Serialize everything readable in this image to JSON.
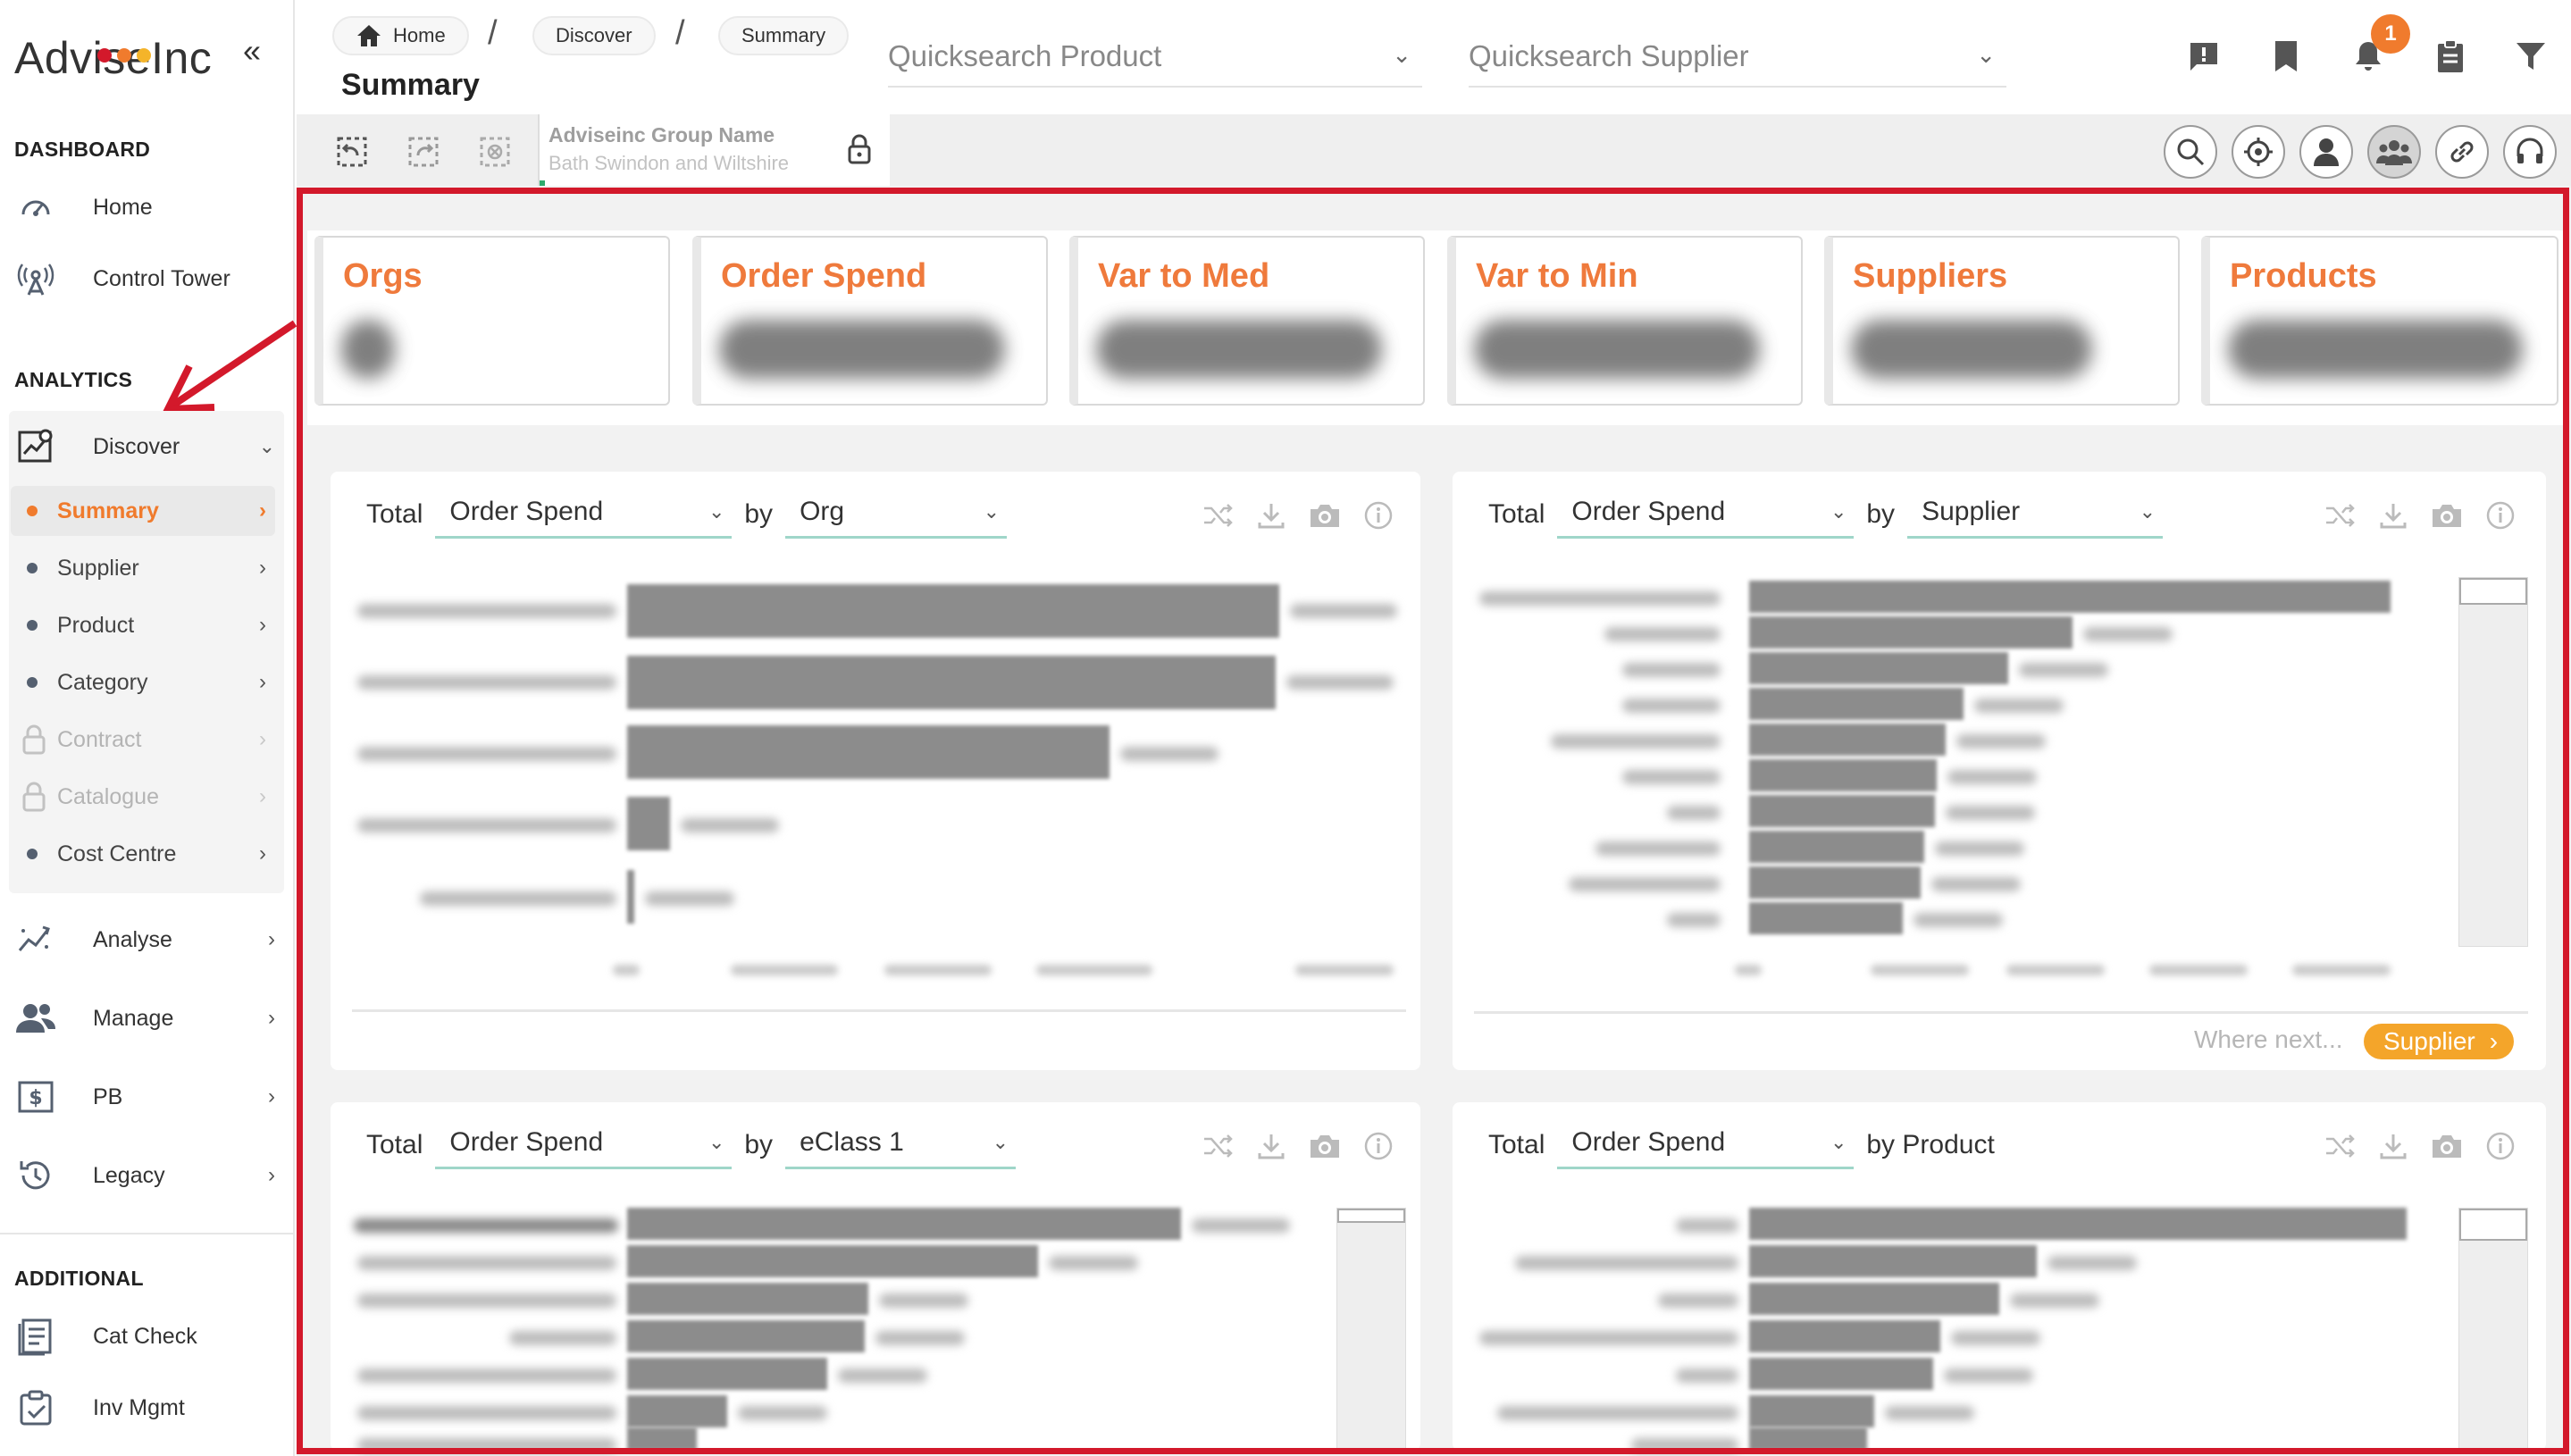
{
  "app": {
    "logo_text": "AdviseInc",
    "collapse_glyph": "«"
  },
  "colors": {
    "accent": "#f07b2d",
    "highlight_border": "#d3192b",
    "kpi_title": "#ef7a3c",
    "select_underline": "#9fd6c9",
    "next_pill": "#f4a52a"
  },
  "sidebar": {
    "dashboard_heading": "DASHBOARD",
    "dashboard_items": [
      {
        "label": "Home",
        "icon": "speedometer-icon"
      },
      {
        "label": "Control Tower",
        "icon": "antenna-icon"
      }
    ],
    "analytics_heading": "ANALYTICS",
    "discover": {
      "label": "Discover",
      "icon": "discover-chart-icon",
      "expanded": true
    },
    "discover_sub": [
      {
        "label": "Summary",
        "active": true,
        "locked": false
      },
      {
        "label": "Supplier",
        "active": false,
        "locked": false
      },
      {
        "label": "Product",
        "active": false,
        "locked": false
      },
      {
        "label": "Category",
        "active": false,
        "locked": false
      },
      {
        "label": "Contract",
        "active": false,
        "locked": true
      },
      {
        "label": "Catalogue",
        "active": false,
        "locked": true
      },
      {
        "label": "Cost Centre",
        "active": false,
        "locked": false
      }
    ],
    "analytics_items": [
      {
        "label": "Analyse",
        "icon": "trend-icon"
      },
      {
        "label": "Manage",
        "icon": "users-icon"
      },
      {
        "label": "PB",
        "icon": "dollar-box-icon"
      },
      {
        "label": "Legacy",
        "icon": "history-icon"
      }
    ],
    "additional_heading": "ADDITIONAL",
    "additional_items": [
      {
        "label": "Cat Check",
        "icon": "checklist-icon"
      },
      {
        "label": "Inv Mgmt",
        "icon": "clipboard-check-icon"
      }
    ]
  },
  "header": {
    "breadcrumbs": [
      "Home",
      "Discover",
      "Summary"
    ],
    "breadcrumb_sep": "/",
    "page_title": "Summary",
    "quicksearch_product": "Quicksearch Product",
    "quicksearch_supplier": "Quicksearch Supplier",
    "notification_count": "1",
    "icons": [
      "feedback-icon",
      "bookmark-icon",
      "bell-icon",
      "clipboard-icon",
      "filter-icon"
    ]
  },
  "toolbar": {
    "group_label": "Adviseinc Group Name",
    "group_value": "Bath Swindon and Wiltshire",
    "right_icons": [
      "search-icon",
      "target-icon",
      "user-icon",
      "team-icon",
      "link-icon",
      "headset-icon"
    ]
  },
  "kpis": [
    "Orgs",
    "Order Spend",
    "Var to Med",
    "Var to Min",
    "Suppliers",
    "Products"
  ],
  "cards": [
    {
      "total_label": "Total",
      "metric": "Order Spend",
      "by_label": "by",
      "dimension": "Org"
    },
    {
      "total_label": "Total",
      "metric": "Order Spend",
      "by_label": "by",
      "dimension": "Supplier",
      "where_next": "Where next...",
      "next_button": "Supplier"
    },
    {
      "total_label": "Total",
      "metric": "Order Spend",
      "by_label": "by",
      "dimension": "eClass 1"
    },
    {
      "total_label": "Total",
      "metric": "Order Spend",
      "by_label": "by Product",
      "dimension": ""
    }
  ]
}
